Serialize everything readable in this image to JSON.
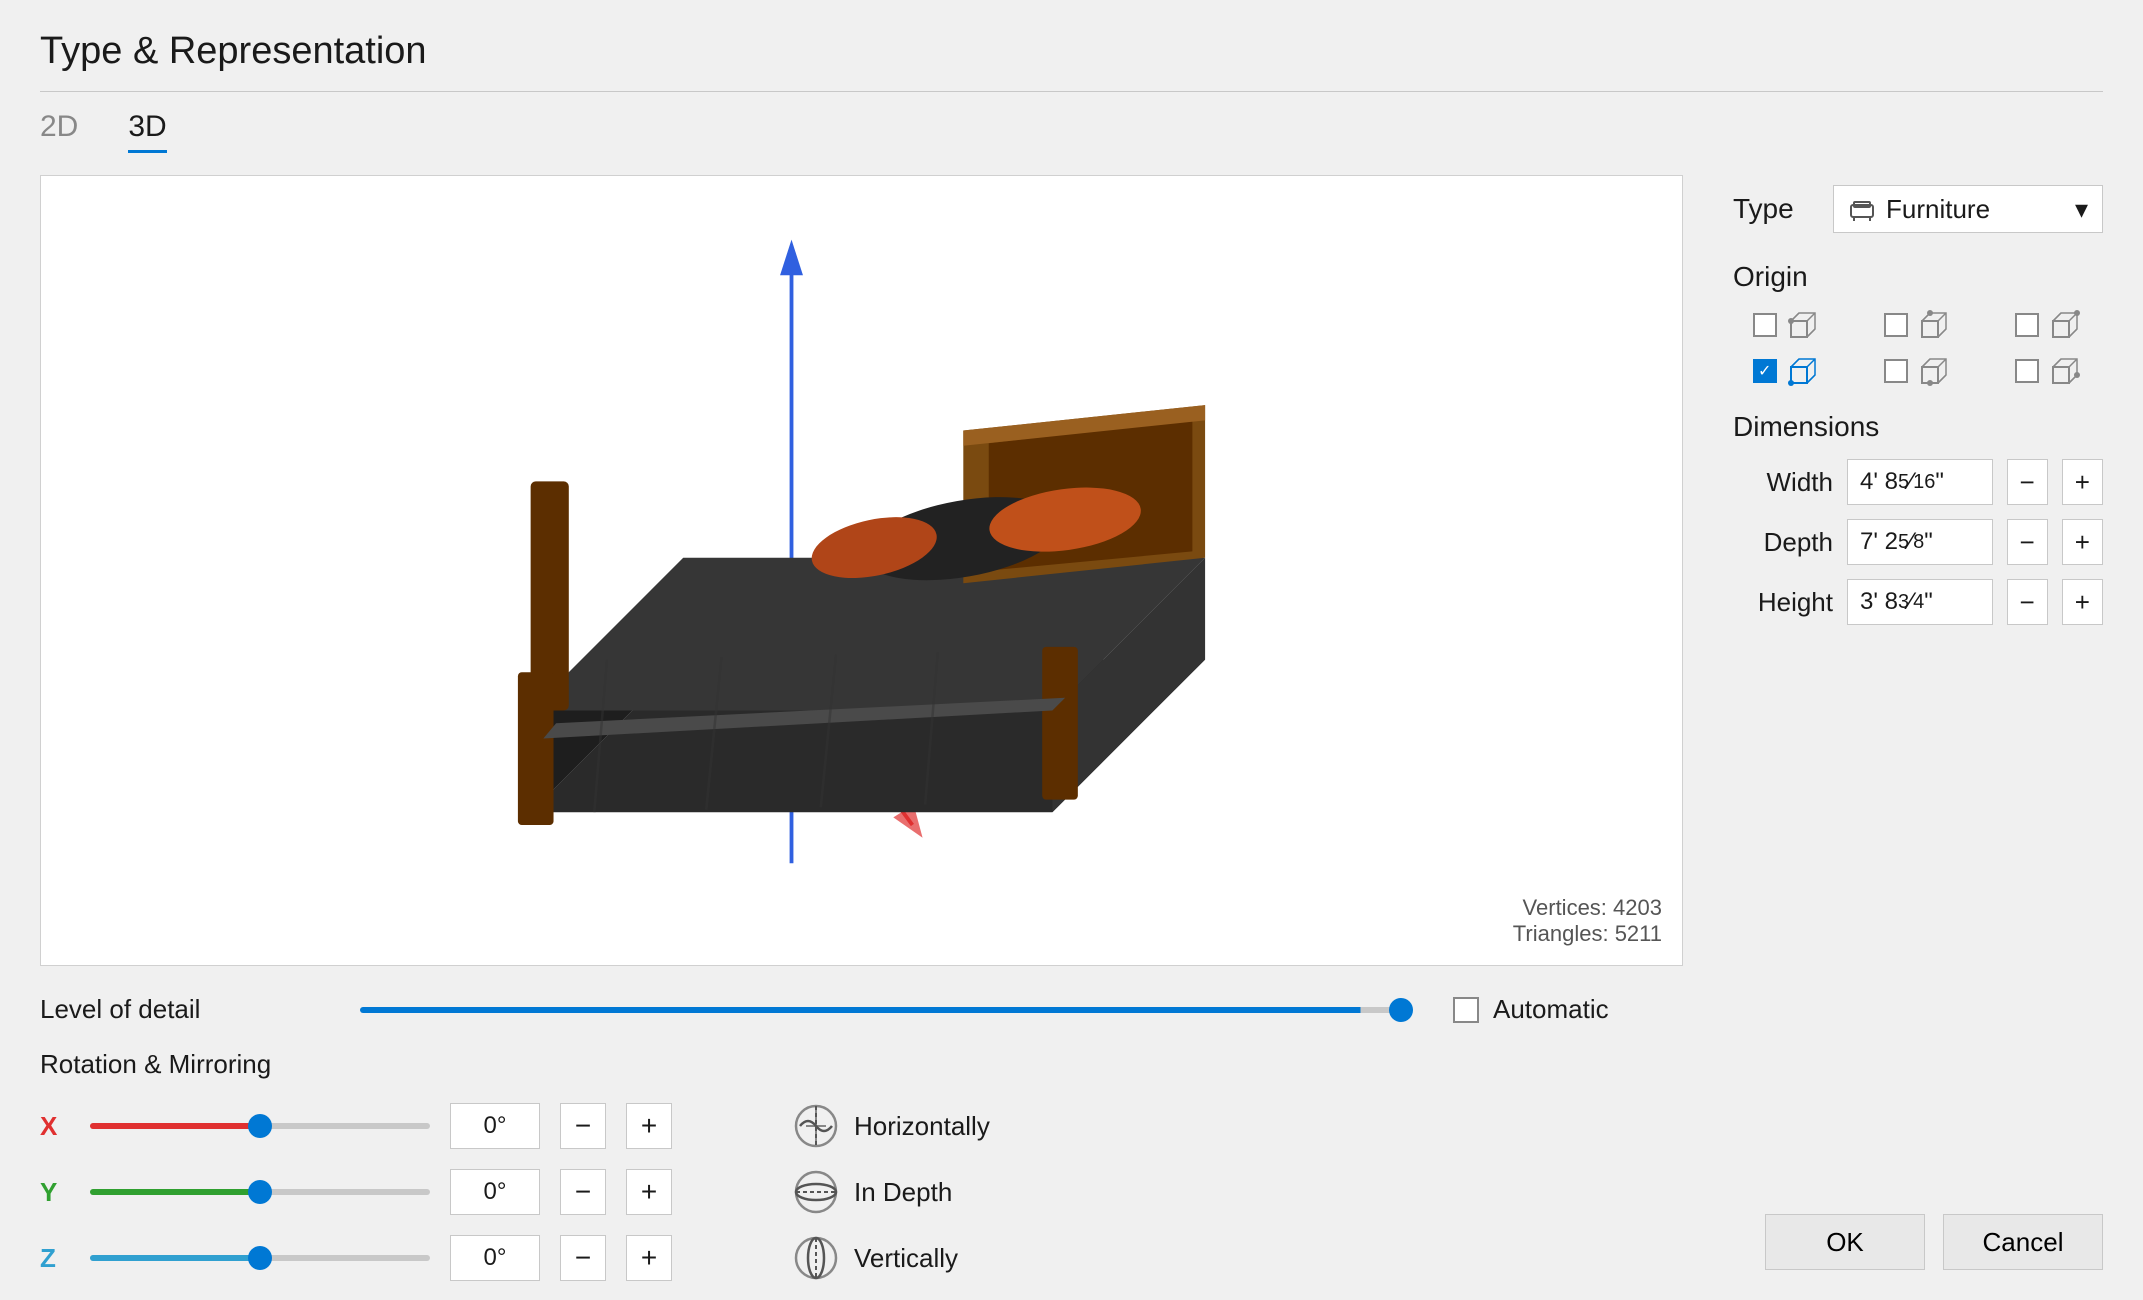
{
  "title": "Type & Representation",
  "tabs": [
    {
      "label": "2D",
      "active": false
    },
    {
      "label": "3D",
      "active": true
    }
  ],
  "viewport": {
    "vertices_label": "Vertices:",
    "vertices_value": "4203",
    "triangles_label": "Triangles:",
    "triangles_value": "5211"
  },
  "lod": {
    "label": "Level of detail",
    "automatic_label": "Automatic",
    "slider_pct": 95
  },
  "rotation": {
    "section_label": "Rotation & Mirroring",
    "axes": [
      {
        "name": "X",
        "value": "0°",
        "color": "x"
      },
      {
        "name": "Y",
        "value": "0°",
        "color": "y"
      },
      {
        "name": "Z",
        "value": "0°",
        "color": "z"
      }
    ],
    "mirrors": [
      {
        "label": "Horizontally"
      },
      {
        "label": "In Depth"
      },
      {
        "label": "Vertically"
      }
    ]
  },
  "right_panel": {
    "type_label": "Type",
    "type_value": "Furniture",
    "origin_label": "Origin",
    "origin_cells": [
      {
        "checked": false,
        "row": 0,
        "col": 0
      },
      {
        "checked": false,
        "row": 0,
        "col": 1
      },
      {
        "checked": false,
        "row": 0,
        "col": 2
      },
      {
        "checked": true,
        "row": 1,
        "col": 0
      },
      {
        "checked": false,
        "row": 1,
        "col": 1
      },
      {
        "checked": false,
        "row": 1,
        "col": 2
      }
    ],
    "dimensions_label": "Dimensions",
    "dims": [
      {
        "label": "Width",
        "value": "4' 8 5⁄16\""
      },
      {
        "label": "Depth",
        "value": "7' 2 5⁄8\""
      },
      {
        "label": "Height",
        "value": "3' 8 3⁄4\""
      }
    ]
  },
  "buttons": {
    "ok": "OK",
    "cancel": "Cancel"
  }
}
